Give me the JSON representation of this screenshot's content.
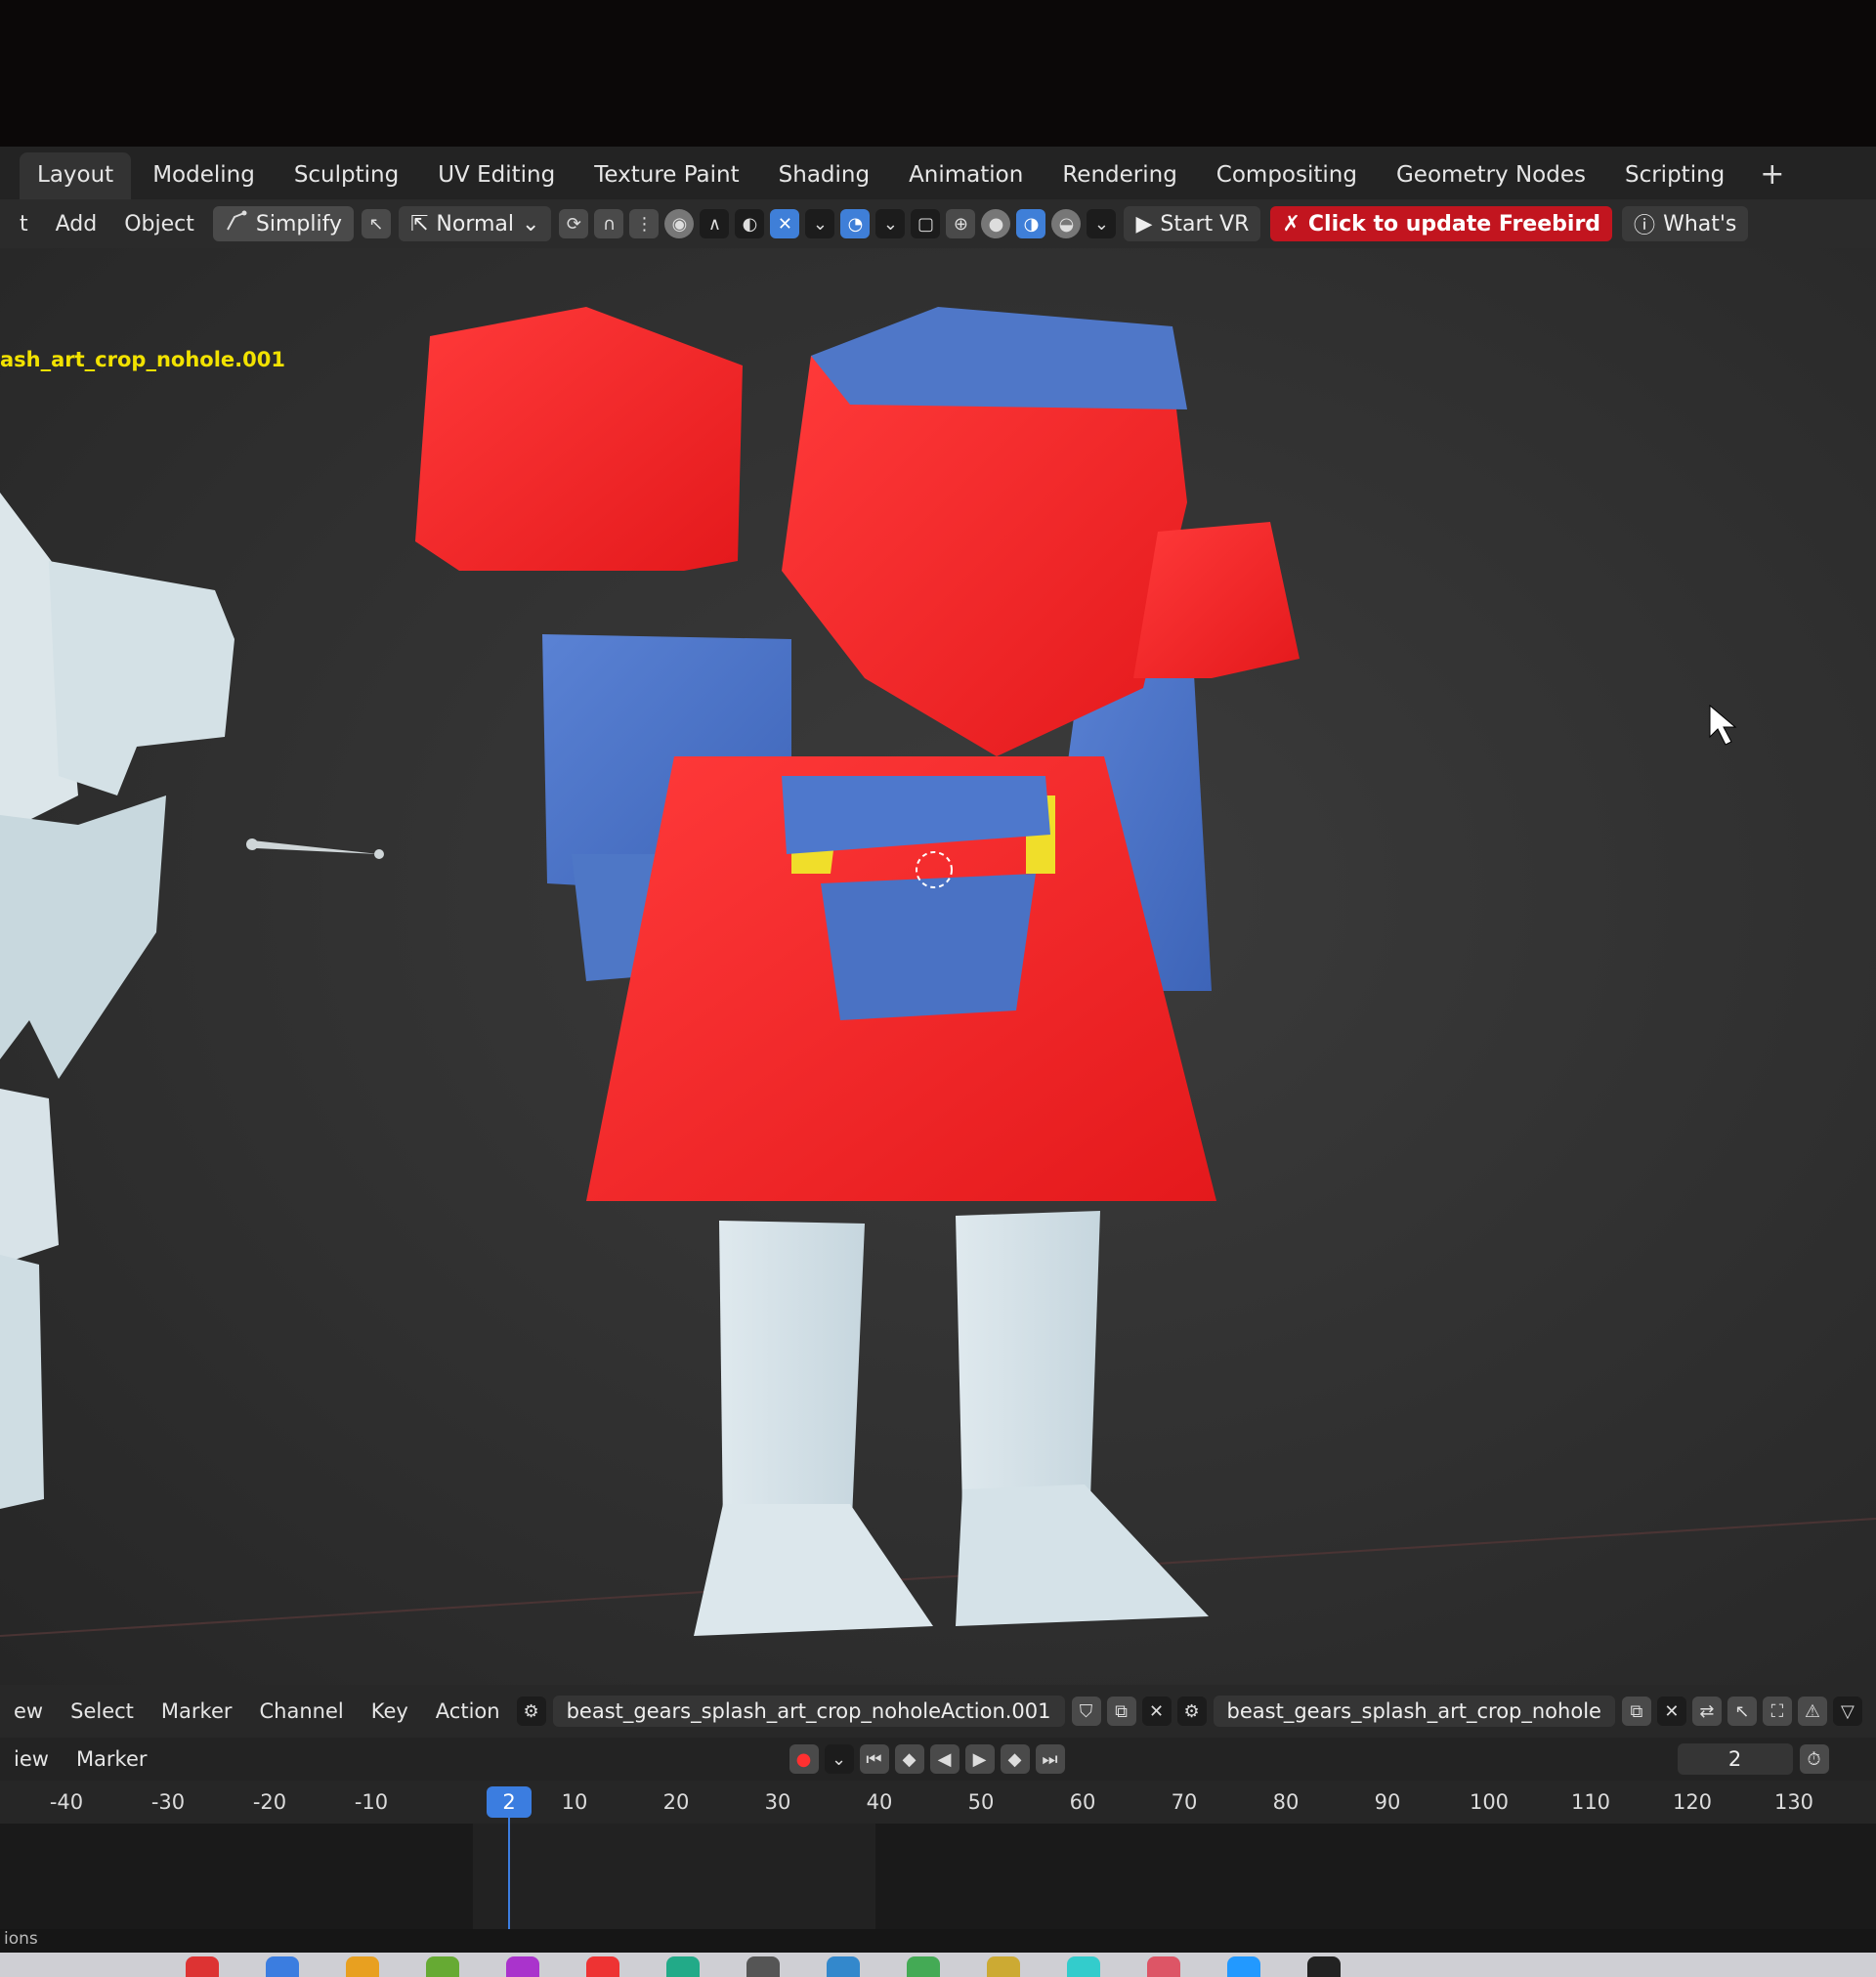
{
  "workspace_tabs": [
    "Layout",
    "Modeling",
    "Sculpting",
    "UV Editing",
    "Texture Paint",
    "Shading",
    "Animation",
    "Rendering",
    "Compositing",
    "Geometry Nodes",
    "Scripting"
  ],
  "workspace_add": "+",
  "header": {
    "menus": [
      "t",
      "Add",
      "Object"
    ],
    "simplify_label": "Simplify",
    "mode_label": "Normal",
    "start_vr_label": "Start VR",
    "freebird_label": "Click to update Freebird",
    "whats_label": "What's"
  },
  "viewport": {
    "object_name": "ash_art_crop_nohole.001"
  },
  "timeline": {
    "menus": [
      "ew",
      "Select",
      "Marker",
      "Channel",
      "Key",
      "Action"
    ],
    "action_name": "beast_gears_splash_art_crop_noholeAction.001",
    "object_name": "beast_gears_splash_art_crop_nohole",
    "sub_menus": [
      "iew",
      "Marker"
    ],
    "current_frame": "2",
    "frame_field": "2",
    "ruler_ticks": [
      "-40",
      "-30",
      "-20",
      "-10",
      "10",
      "20",
      "30",
      "40",
      "50",
      "60",
      "70",
      "80",
      "90",
      "100",
      "110",
      "120",
      "130"
    ],
    "status_text": "ions"
  },
  "colors": {
    "accent_blue": "#3b7de0",
    "freebird_red": "#c2151f",
    "object_name_yellow": "#f2e200",
    "robot_red": "#f02a2a",
    "robot_blue": "#4a72c4"
  }
}
